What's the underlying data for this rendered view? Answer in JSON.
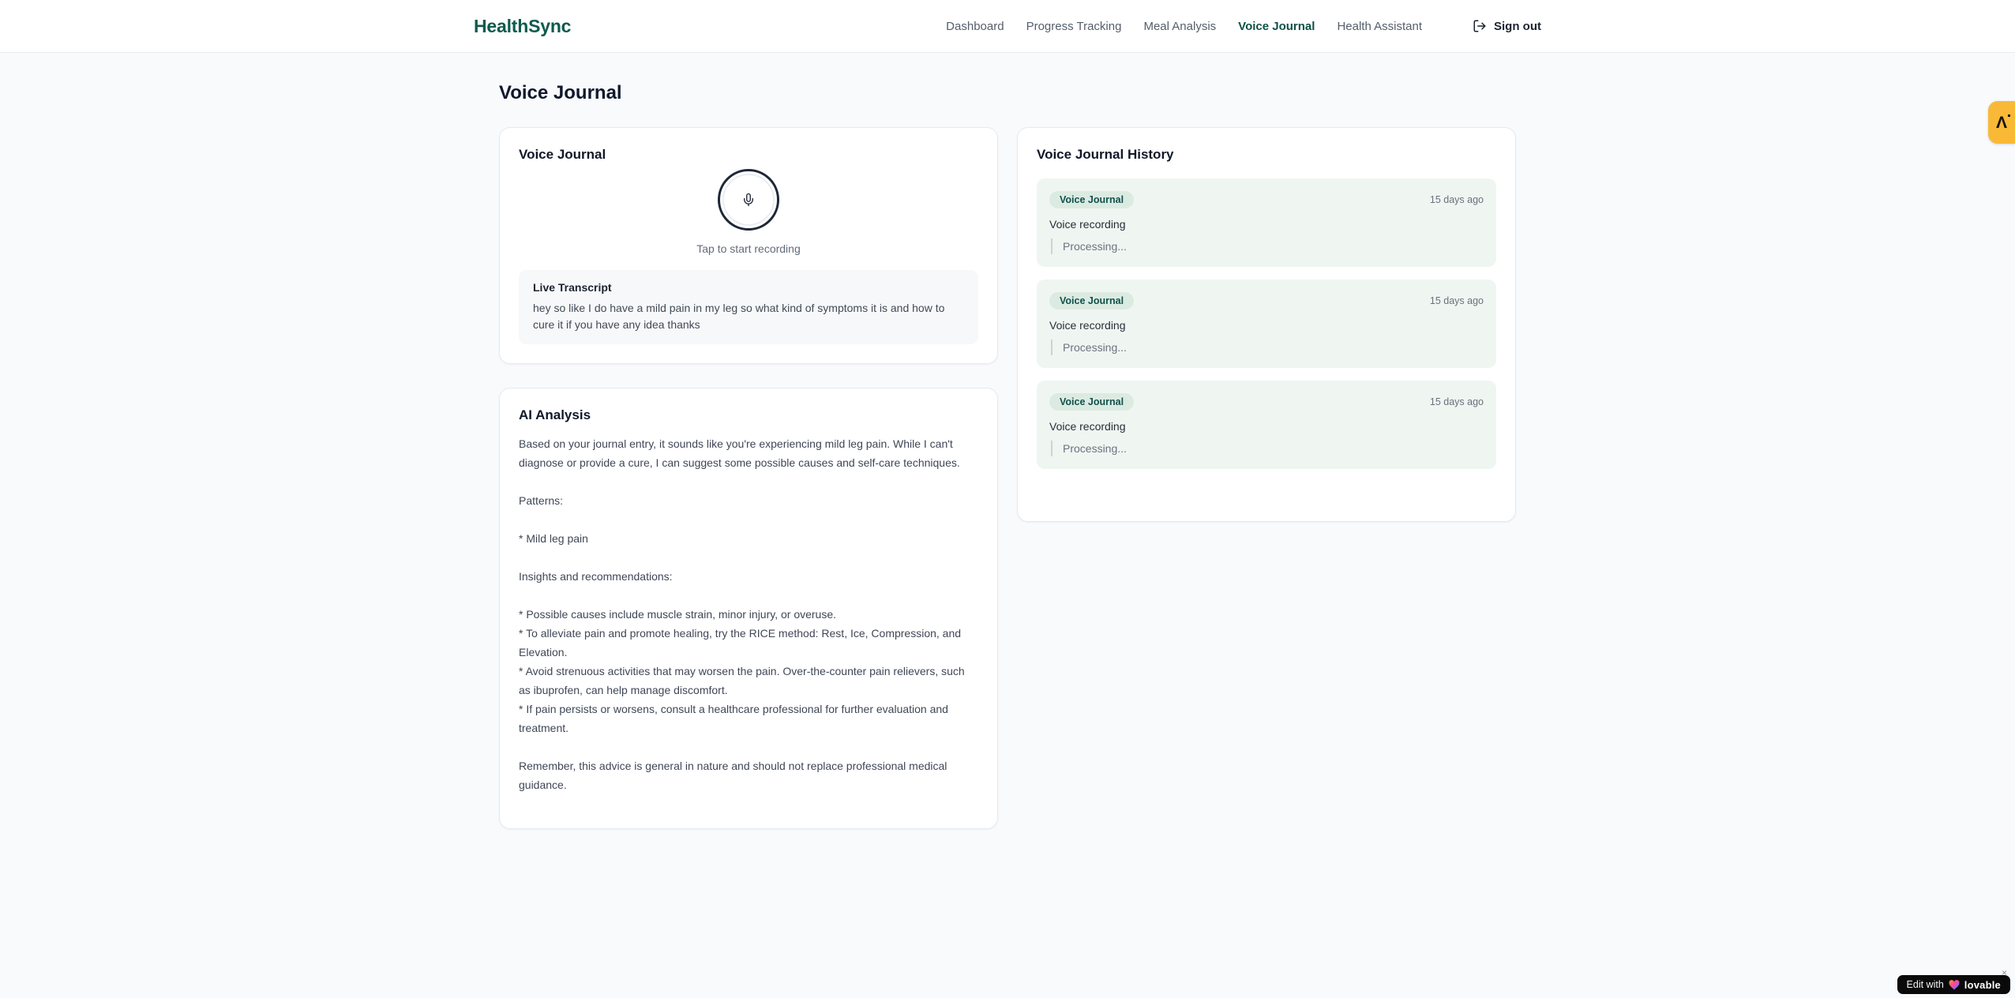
{
  "brand": "HealthSync",
  "nav": {
    "items": [
      {
        "label": "Dashboard"
      },
      {
        "label": "Progress Tracking"
      },
      {
        "label": "Meal Analysis"
      },
      {
        "label": "Voice Journal"
      },
      {
        "label": "Health Assistant"
      }
    ],
    "active_item": "Voice Journal",
    "signout_label": "Sign out"
  },
  "page": {
    "title": "Voice Journal"
  },
  "recorder_card": {
    "title": "Voice Journal",
    "tap_hint": "Tap to start recording",
    "transcript": {
      "title": "Live Transcript",
      "text": "hey so like I do have a mild pain in my leg so what kind of symptoms it is and how to cure it if you have any idea thanks"
    }
  },
  "analysis_card": {
    "title": "AI Analysis",
    "body": "Based on your journal entry, it sounds like you're experiencing mild leg pain. While I can't diagnose or provide a cure, I can suggest some possible causes and self-care techniques.\n\nPatterns:\n\n* Mild leg pain\n\nInsights and recommendations:\n\n* Possible causes include muscle strain, minor injury, or overuse.\n* To alleviate pain and promote healing, try the RICE method: Rest, Ice, Compression, and Elevation.\n* Avoid strenuous activities that may worsen the pain. Over-the-counter pain relievers, such as ibuprofen, can help manage discomfort.\n* If pain persists or worsens, consult a healthcare professional for further evaluation and treatment.\n\nRemember, this advice is general in nature and should not replace professional medical guidance."
  },
  "history_card": {
    "title": "Voice Journal History",
    "items": [
      {
        "badge": "Voice Journal",
        "time": "15 days ago",
        "label": "Voice recording",
        "status": "Processing..."
      },
      {
        "badge": "Voice Journal",
        "time": "15 days ago",
        "label": "Voice recording",
        "status": "Processing..."
      },
      {
        "badge": "Voice Journal",
        "time": "15 days ago",
        "label": "Voice recording",
        "status": "Processing..."
      }
    ]
  },
  "overlays": {
    "side_tab_glyph": "Λ",
    "edit_badge": {
      "prefix": "Edit with",
      "brand": "lovable",
      "close": "×"
    }
  },
  "colors": {
    "brand_teal": "#0e5a4e",
    "nav_active": "#0f5147",
    "page_bg": "#f8fafc",
    "history_item_bg": "#eff6f1",
    "badge_bg": "#dcebe2",
    "badge_text": "#10514a",
    "side_tab_amber": "#f9b937",
    "lovable_black": "#0a0a0a"
  }
}
